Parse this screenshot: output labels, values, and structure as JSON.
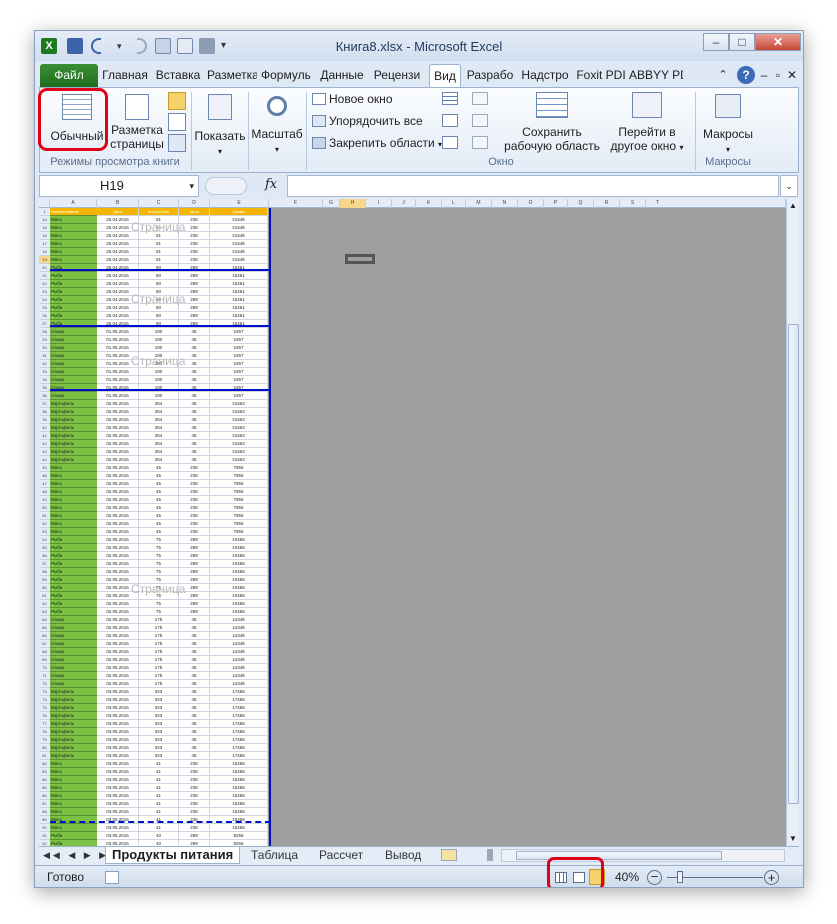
{
  "title": "Книга8.xlsx - Microsoft Excel",
  "tabs": [
    "Файл",
    "Главная",
    "Вставка",
    "Разметка",
    "Формулы",
    "Данные",
    "Рецензи",
    "Вид",
    "Разрабо",
    "Надстро",
    "Foxit PDI",
    "ABBYY PD"
  ],
  "ribbon": {
    "normal": "Обычный",
    "page_layout_1": "Разметка",
    "page_layout_2": "страницы",
    "group_views": "Режимы просмотра книги",
    "show": "Показать",
    "zoom": "Масштаб",
    "new_window": "Новое окно",
    "arrange_all": "Упорядочить все",
    "freeze": "Закрепить области",
    "save_ws_1": "Сохранить",
    "save_ws_2": "рабочую область",
    "switch_1": "Перейти в",
    "switch_2": "другое окно",
    "group_window": "Окно",
    "macros": "Макросы",
    "group_macros": "Макросы"
  },
  "formula": {
    "namebox": "H19",
    "fx": "fx"
  },
  "columns": [
    "A",
    "B",
    "C",
    "D",
    "E",
    "F",
    "G",
    "H",
    "I",
    "J",
    "K",
    "L",
    "M",
    "N",
    "O",
    "P",
    "Q",
    "R",
    "S",
    "T"
  ],
  "header_row": {
    "num": "1",
    "a": "Наименование",
    "b": "Дата",
    "c": "Количество",
    "d": "Цена",
    "e": "Сумма"
  },
  "rows": [
    {
      "n": "14",
      "a": "Мясо",
      "b": "20.04.2016",
      "c": "91",
      "d": "236",
      "e": "21546"
    },
    {
      "n": "15",
      "a": "Мясо",
      "b": "20.04.2016",
      "c": "91",
      "d": "236",
      "e": "21546"
    },
    {
      "n": "16",
      "a": "Мясо",
      "b": "20.04.2016",
      "c": "91",
      "d": "236",
      "e": "21546"
    },
    {
      "n": "17",
      "a": "Мясо",
      "b": "20.04.2016",
      "c": "91",
      "d": "236",
      "e": "21546"
    },
    {
      "n": "18",
      "a": "Мясо",
      "b": "20.04.2016",
      "c": "91",
      "d": "236",
      "e": "21546"
    },
    {
      "n": "19",
      "a": "Мясо",
      "b": "20.04.2016",
      "c": "91",
      "d": "236",
      "e": "21546"
    },
    {
      "n": "20",
      "a": "Рыба",
      "b": "20.04.2016",
      "c": "60",
      "d": "289",
      "e": "15461"
    },
    {
      "n": "21",
      "a": "Рыба",
      "b": "20.04.2016",
      "c": "60",
      "d": "289",
      "e": "15461"
    },
    {
      "n": "22",
      "a": "Рыба",
      "b": "20.04.2016",
      "c": "60",
      "d": "289",
      "e": "15461"
    },
    {
      "n": "23",
      "a": "Рыба",
      "b": "20.04.2016",
      "c": "60",
      "d": "289",
      "e": "15461"
    },
    {
      "n": "24",
      "a": "Рыба",
      "b": "20.04.2016",
      "c": "60",
      "d": "289",
      "e": "15461"
    },
    {
      "n": "25",
      "a": "Рыба",
      "b": "20.04.2016",
      "c": "60",
      "d": "289",
      "e": "15461"
    },
    {
      "n": "26",
      "a": "Рыба",
      "b": "20.04.2016",
      "c": "60",
      "d": "289",
      "e": "15461"
    },
    {
      "n": "27",
      "a": "Рыба",
      "b": "20.04.2016",
      "c": "60",
      "d": "289",
      "e": "15461"
    },
    {
      "n": "28",
      "a": "Сахар",
      "b": "01.05.2016",
      "c": "190",
      "d": "45",
      "e": "2457"
    },
    {
      "n": "29",
      "a": "Сахар",
      "b": "01.05.2016",
      "c": "190",
      "d": "45",
      "e": "2457"
    },
    {
      "n": "30",
      "a": "Сахар",
      "b": "01.05.2016",
      "c": "190",
      "d": "45",
      "e": "2457"
    },
    {
      "n": "31",
      "a": "Сахар",
      "b": "01.05.2016",
      "c": "190",
      "d": "45",
      "e": "2457"
    },
    {
      "n": "32",
      "a": "Сахар",
      "b": "01.05.2016",
      "c": "190",
      "d": "45",
      "e": "2457"
    },
    {
      "n": "33",
      "a": "Сахар",
      "b": "01.05.2016",
      "c": "190",
      "d": "45",
      "e": "2457"
    },
    {
      "n": "34",
      "a": "Сахар",
      "b": "01.05.2016",
      "c": "190",
      "d": "45",
      "e": "2457"
    },
    {
      "n": "35",
      "a": "Сахар",
      "b": "01.05.2016",
      "c": "190",
      "d": "45",
      "e": "2457"
    },
    {
      "n": "36",
      "a": "Сахар",
      "b": "01.05.2016",
      "c": "190",
      "d": "45",
      "e": "2457"
    },
    {
      "n": "37",
      "a": "Картофель",
      "b": "02.05.2016",
      "c": "264",
      "d": "45",
      "e": "21563"
    },
    {
      "n": "38",
      "a": "Картофель",
      "b": "02.05.2016",
      "c": "264",
      "d": "45",
      "e": "21563"
    },
    {
      "n": "39",
      "a": "Картофель",
      "b": "02.05.2016",
      "c": "264",
      "d": "45",
      "e": "21563"
    },
    {
      "n": "40",
      "a": "Картофель",
      "b": "02.05.2016",
      "c": "264",
      "d": "45",
      "e": "21563"
    },
    {
      "n": "41",
      "a": "Картофель",
      "b": "02.05.2016",
      "c": "264",
      "d": "45",
      "e": "21563"
    },
    {
      "n": "42",
      "a": "Картофель",
      "b": "02.05.2016",
      "c": "264",
      "d": "45",
      "e": "21563"
    },
    {
      "n": "43",
      "a": "Картофель",
      "b": "02.05.2016",
      "c": "264",
      "d": "45",
      "e": "21563"
    },
    {
      "n": "44",
      "a": "Картофель",
      "b": "02.05.2016",
      "c": "264",
      "d": "45",
      "e": "21563"
    },
    {
      "n": "45",
      "a": "Мясо",
      "b": "02.05.2016",
      "c": "45",
      "d": "236",
      "e": "7855"
    },
    {
      "n": "46",
      "a": "Мясо",
      "b": "02.05.2016",
      "c": "45",
      "d": "236",
      "e": "7855"
    },
    {
      "n": "47",
      "a": "Мясо",
      "b": "02.05.2016",
      "c": "45",
      "d": "236",
      "e": "7855"
    },
    {
      "n": "48",
      "a": "Мясо",
      "b": "02.05.2016",
      "c": "45",
      "d": "236",
      "e": "7855"
    },
    {
      "n": "49",
      "a": "Мясо",
      "b": "02.05.2016",
      "c": "45",
      "d": "236",
      "e": "7855"
    },
    {
      "n": "50",
      "a": "Мясо",
      "b": "02.05.2016",
      "c": "45",
      "d": "236",
      "e": "7855"
    },
    {
      "n": "51",
      "a": "Мясо",
      "b": "02.05.2016",
      "c": "45",
      "d": "236",
      "e": "7855"
    },
    {
      "n": "52",
      "a": "Мясо",
      "b": "02.05.2016",
      "c": "45",
      "d": "236",
      "e": "7855"
    },
    {
      "n": "53",
      "a": "Мясо",
      "b": "02.05.2016",
      "c": "45",
      "d": "236",
      "e": "7855"
    },
    {
      "n": "54",
      "a": "Рыба",
      "b": "02.05.2016",
      "c": "75",
      "d": "289",
      "e": "10456"
    },
    {
      "n": "55",
      "a": "Рыба",
      "b": "02.05.2016",
      "c": "75",
      "d": "289",
      "e": "10456"
    },
    {
      "n": "56",
      "a": "Рыба",
      "b": "02.05.2016",
      "c": "75",
      "d": "289",
      "e": "10456"
    },
    {
      "n": "57",
      "a": "Рыба",
      "b": "02.05.2016",
      "c": "75",
      "d": "289",
      "e": "10456"
    },
    {
      "n": "58",
      "a": "Рыба",
      "b": "02.05.2016",
      "c": "75",
      "d": "289",
      "e": "10456"
    },
    {
      "n": "59",
      "a": "Рыба",
      "b": "02.05.2016",
      "c": "75",
      "d": "289",
      "e": "10456"
    },
    {
      "n": "60",
      "a": "Рыба",
      "b": "02.05.2016",
      "c": "75",
      "d": "289",
      "e": "10456"
    },
    {
      "n": "61",
      "a": "Рыба",
      "b": "02.05.2016",
      "c": "75",
      "d": "289",
      "e": "10456"
    },
    {
      "n": "62",
      "a": "Рыба",
      "b": "02.05.2016",
      "c": "75",
      "d": "289",
      "e": "10456"
    },
    {
      "n": "63",
      "a": "Рыба",
      "b": "02.05.2016",
      "c": "75",
      "d": "289",
      "e": "10456"
    },
    {
      "n": "64",
      "a": "Сахар",
      "b": "02.05.2016",
      "c": "175",
      "d": "45",
      "e": "12346"
    },
    {
      "n": "65",
      "a": "Сахар",
      "b": "02.05.2016",
      "c": "175",
      "d": "45",
      "e": "12346"
    },
    {
      "n": "66",
      "a": "Сахар",
      "b": "02.05.2016",
      "c": "175",
      "d": "45",
      "e": "12346"
    },
    {
      "n": "67",
      "a": "Сахар",
      "b": "02.05.2016",
      "c": "175",
      "d": "45",
      "e": "12346"
    },
    {
      "n": "68",
      "a": "Сахар",
      "b": "02.05.2016",
      "c": "175",
      "d": "45",
      "e": "12346"
    },
    {
      "n": "69",
      "a": "Сахар",
      "b": "02.05.2016",
      "c": "175",
      "d": "45",
      "e": "12346"
    },
    {
      "n": "70",
      "a": "Сахар",
      "b": "02.05.2016",
      "c": "175",
      "d": "45",
      "e": "12346"
    },
    {
      "n": "71",
      "a": "Сахар",
      "b": "02.05.2016",
      "c": "175",
      "d": "45",
      "e": "12346"
    },
    {
      "n": "72",
      "a": "Сахар",
      "b": "02.05.2016",
      "c": "175",
      "d": "45",
      "e": "12346"
    },
    {
      "n": "73",
      "a": "Картофель",
      "b": "03.05.2016",
      "c": "343",
      "d": "45",
      "e": "17456"
    },
    {
      "n": "74",
      "a": "Картофель",
      "b": "03.05.2016",
      "c": "343",
      "d": "45",
      "e": "17456"
    },
    {
      "n": "75",
      "a": "Картофель",
      "b": "03.05.2016",
      "c": "343",
      "d": "45",
      "e": "17456"
    },
    {
      "n": "76",
      "a": "Картофель",
      "b": "03.05.2016",
      "c": "343",
      "d": "45",
      "e": "17456"
    },
    {
      "n": "77",
      "a": "Картофель",
      "b": "03.05.2016",
      "c": "343",
      "d": "45",
      "e": "17456"
    },
    {
      "n": "78",
      "a": "Картофель",
      "b": "03.05.2016",
      "c": "343",
      "d": "45",
      "e": "17456"
    },
    {
      "n": "79",
      "a": "Картофель",
      "b": "03.05.2016",
      "c": "343",
      "d": "45",
      "e": "17456"
    },
    {
      "n": "80",
      "a": "Картофель",
      "b": "03.05.2016",
      "c": "343",
      "d": "45",
      "e": "17456"
    },
    {
      "n": "81",
      "a": "Картофель",
      "b": "03.05.2016",
      "c": "343",
      "d": "45",
      "e": "17456"
    },
    {
      "n": "82",
      "a": "Мясо",
      "b": "03.05.2016",
      "c": "41",
      "d": "236",
      "e": "15456"
    },
    {
      "n": "83",
      "a": "Мясо",
      "b": "03.05.2016",
      "c": "41",
      "d": "236",
      "e": "15456"
    },
    {
      "n": "84",
      "a": "Мясо",
      "b": "03.05.2016",
      "c": "41",
      "d": "236",
      "e": "15456"
    },
    {
      "n": "85",
      "a": "Мясо",
      "b": "03.05.2016",
      "c": "41",
      "d": "236",
      "e": "15456"
    },
    {
      "n": "86",
      "a": "Мясо",
      "b": "03.05.2016",
      "c": "41",
      "d": "236",
      "e": "15456"
    },
    {
      "n": "87",
      "a": "Мясо",
      "b": "03.05.2016",
      "c": "41",
      "d": "236",
      "e": "15456"
    },
    {
      "n": "88",
      "a": "Мясо",
      "b": "03.05.2016",
      "c": "41",
      "d": "236",
      "e": "15456"
    },
    {
      "n": "89",
      "a": "Мясо",
      "b": "03.05.2016",
      "c": "41",
      "d": "236",
      "e": "15456"
    },
    {
      "n": "90",
      "a": "Мясо",
      "b": "03.05.2016",
      "c": "41",
      "d": "236",
      "e": "15456"
    },
    {
      "n": "91",
      "a": "Рыба",
      "b": "03.05.2016",
      "c": "40",
      "d": "289",
      "e": "8256"
    },
    {
      "n": "92",
      "a": "Рыба",
      "b": "03.05.2016",
      "c": "40",
      "d": "289",
      "e": "8256"
    }
  ],
  "watermark": "Страница",
  "sheets": [
    "Продукты питания",
    "Таблица",
    "Рассчет",
    "Вывод"
  ],
  "status": {
    "ready": "Готово",
    "zoom": "40%"
  },
  "colors": {
    "accent": "#e0001a",
    "file_tab": "#2a7d26",
    "header_fill": "#f5b400",
    "name_fill": "#7bc143",
    "page_break": "#0010c8"
  }
}
